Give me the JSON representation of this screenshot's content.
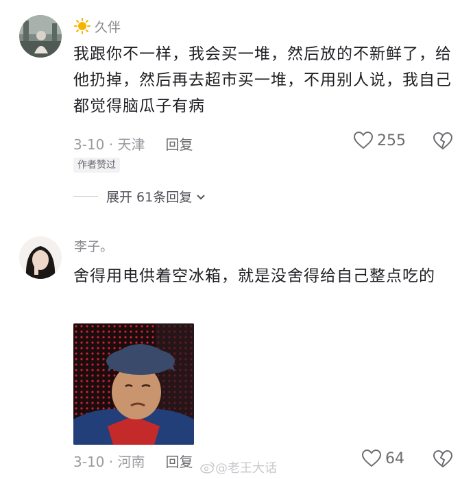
{
  "comments": [
    {
      "username": "久伴",
      "text": "我跟你不一样，我会买一堆，然后放的不新鲜了，给他扔掉，然后再去超市买一堆，不用别人说，我自己都觉得脑瓜子有病",
      "meta": "3-10 · 天津",
      "reply_label": "回复",
      "likes": "255",
      "author_badge": "作者赞过",
      "expand_label": "展开 61条回复"
    },
    {
      "username": "李子。",
      "text": "舍得用电供着空冰箱，就是没舍得给自己整点吃的",
      "meta": "3-10 · 河南",
      "reply_label": "回复",
      "likes": "64"
    }
  ],
  "watermark": "@老王大话",
  "colors": {
    "muted": "#8a8a8f",
    "text": "#1f1f24",
    "icon": "#6b6b70",
    "sun": "#f5b400"
  }
}
